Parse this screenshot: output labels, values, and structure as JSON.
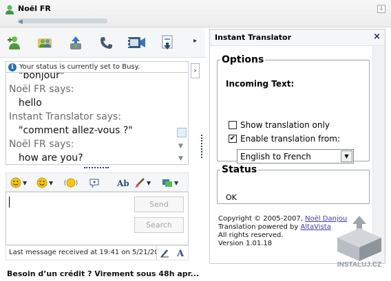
{
  "window": {
    "title": "Noël FR"
  },
  "toolbar": {
    "buttons": [
      {
        "name": "add-contact-icon"
      },
      {
        "name": "invite-icon"
      },
      {
        "name": "send-file-icon"
      },
      {
        "name": "call-icon"
      },
      {
        "name": "video-icon"
      },
      {
        "name": "activities-icon"
      }
    ],
    "more": "▸"
  },
  "status": {
    "text": "Your status is currently set to Busy."
  },
  "chat": {
    "lines": [
      {
        "type": "msg",
        "text": "\"bonjour\""
      },
      {
        "type": "speaker",
        "text": "Noël FR says:"
      },
      {
        "type": "msg",
        "text": "hello"
      },
      {
        "type": "speaker",
        "text": "Instant Translator says:"
      },
      {
        "type": "msg",
        "text": "\"comment allez-vous ?\""
      },
      {
        "type": "speaker",
        "text": "Noël FR says:"
      },
      {
        "type": "msg",
        "text": "how are you?"
      }
    ]
  },
  "compose": {
    "send_label": "Send",
    "search_label": "Search"
  },
  "footer": {
    "last_message": "Last message received at 19:41 on 5/21/20",
    "ad_text": "Besoin d’un crédit ? Virement sous 48h apr..."
  },
  "panel": {
    "title": "Instant Translator",
    "options": {
      "legend": "Options",
      "incoming_label": "Incoming Text:",
      "show_only_label": "Show translation only",
      "show_only_checked": false,
      "enable_label": "Enable translation from:",
      "enable_checked": true,
      "language": "English to French"
    },
    "status": {
      "legend": "Status",
      "value": "OK"
    },
    "about": {
      "copyright_prefix": "Copyright © 2005-2007,",
      "author": "Noël Danjou",
      "powered_prefix": "Translation powered by",
      "provider": "AltaVista",
      "rights": "All rights reserved.",
      "version": "Version 1.01.18"
    }
  },
  "watermark": {
    "text": "INSTALUJ.CZ"
  }
}
